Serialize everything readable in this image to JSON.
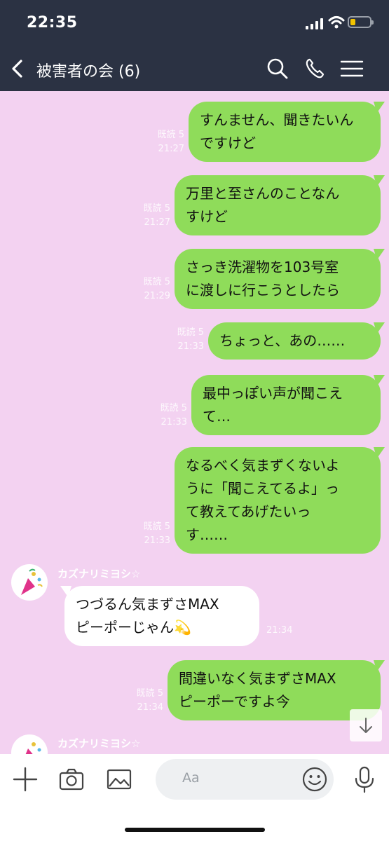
{
  "status": {
    "time": "22:35"
  },
  "header": {
    "title": "被害者の会 (6)",
    "back_icon": "back-chevron-icon",
    "search_icon": "search-icon",
    "call_icon": "phone-icon",
    "menu_icon": "menu-icon"
  },
  "messages": [
    {
      "dir": "out",
      "read": "既読 5",
      "time": "21:27",
      "lines": [
        "すんません、聞きたいん",
        "ですけど"
      ]
    },
    {
      "dir": "out",
      "read": "既読 5",
      "time": "21:27",
      "lines": [
        "万里と至さんのことなん",
        "すけど"
      ]
    },
    {
      "dir": "out",
      "read": "既読 5",
      "time": "21:29",
      "lines": [
        "さっき洗濯物を103号室",
        "に渡しに行こうとしたら"
      ]
    },
    {
      "dir": "out",
      "read": "既読 5",
      "time": "21:33",
      "lines": [
        "ちょっと、あの……"
      ]
    },
    {
      "dir": "out",
      "read": "既読 5",
      "time": "21:33",
      "lines": [
        "最中っぽい声が聞こえ",
        "て…"
      ]
    },
    {
      "dir": "out",
      "read": "既読 5",
      "time": "21:33",
      "lines": [
        "なるべく気まずくないよ",
        "うに「聞こえてるよ」っ",
        "て教えてあげたいっ",
        "す……"
      ]
    },
    {
      "dir": "in",
      "sender": "カズナリミヨシ☆",
      "time": "21:34",
      "lines": [
        "つづるん気まずさMAX",
        "ピーポーじゃん💫"
      ]
    },
    {
      "dir": "out",
      "read": "既読 5",
      "time": "21:34",
      "lines": [
        "間違いなく気まずさMAX",
        "ピーポーですよ今"
      ]
    },
    {
      "dir": "in",
      "sender": "カズナリミヨシ☆"
    }
  ],
  "input": {
    "placeholder": "Aa",
    "plus_icon": "plus-icon",
    "camera_icon": "camera-icon",
    "image_icon": "image-icon",
    "emoji_icon": "emoji-icon",
    "mic_icon": "mic-icon"
  },
  "colors": {
    "header_bg": "#2b3243",
    "chat_bg": "#f3d2f1",
    "outgoing_bubble": "#8fdc5a",
    "incoming_bubble": "#ffffff"
  }
}
